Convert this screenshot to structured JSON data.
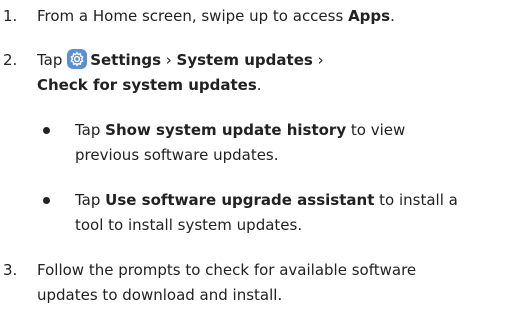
{
  "steps": [
    {
      "num": "1.",
      "text_pre": "From a Home screen, swipe up to access ",
      "bold": "Apps",
      "text_post": "."
    },
    {
      "num": "2.",
      "tap": "Tap",
      "icon": "settings-gear-icon",
      "path1": "Settings",
      "sep1": " › ",
      "path2": "System updates",
      "sep2": " ›",
      "path3": "Check for system updates",
      "end": "."
    },
    {
      "num": "3.",
      "line1": "Follow the prompts to check for available software",
      "line2": "updates to download and install."
    }
  ],
  "substeps": [
    {
      "tap": "Tap ",
      "bold": "Show system update history",
      "line1_post": " to view",
      "line2": "previous software updates."
    },
    {
      "tap": "Tap ",
      "bold": "Use software upgrade assistant",
      "line1_post": " to install a",
      "line2": "tool to install system updates."
    }
  ],
  "colors": {
    "text": "#222222",
    "icon_bg": "#5a8fd7"
  }
}
